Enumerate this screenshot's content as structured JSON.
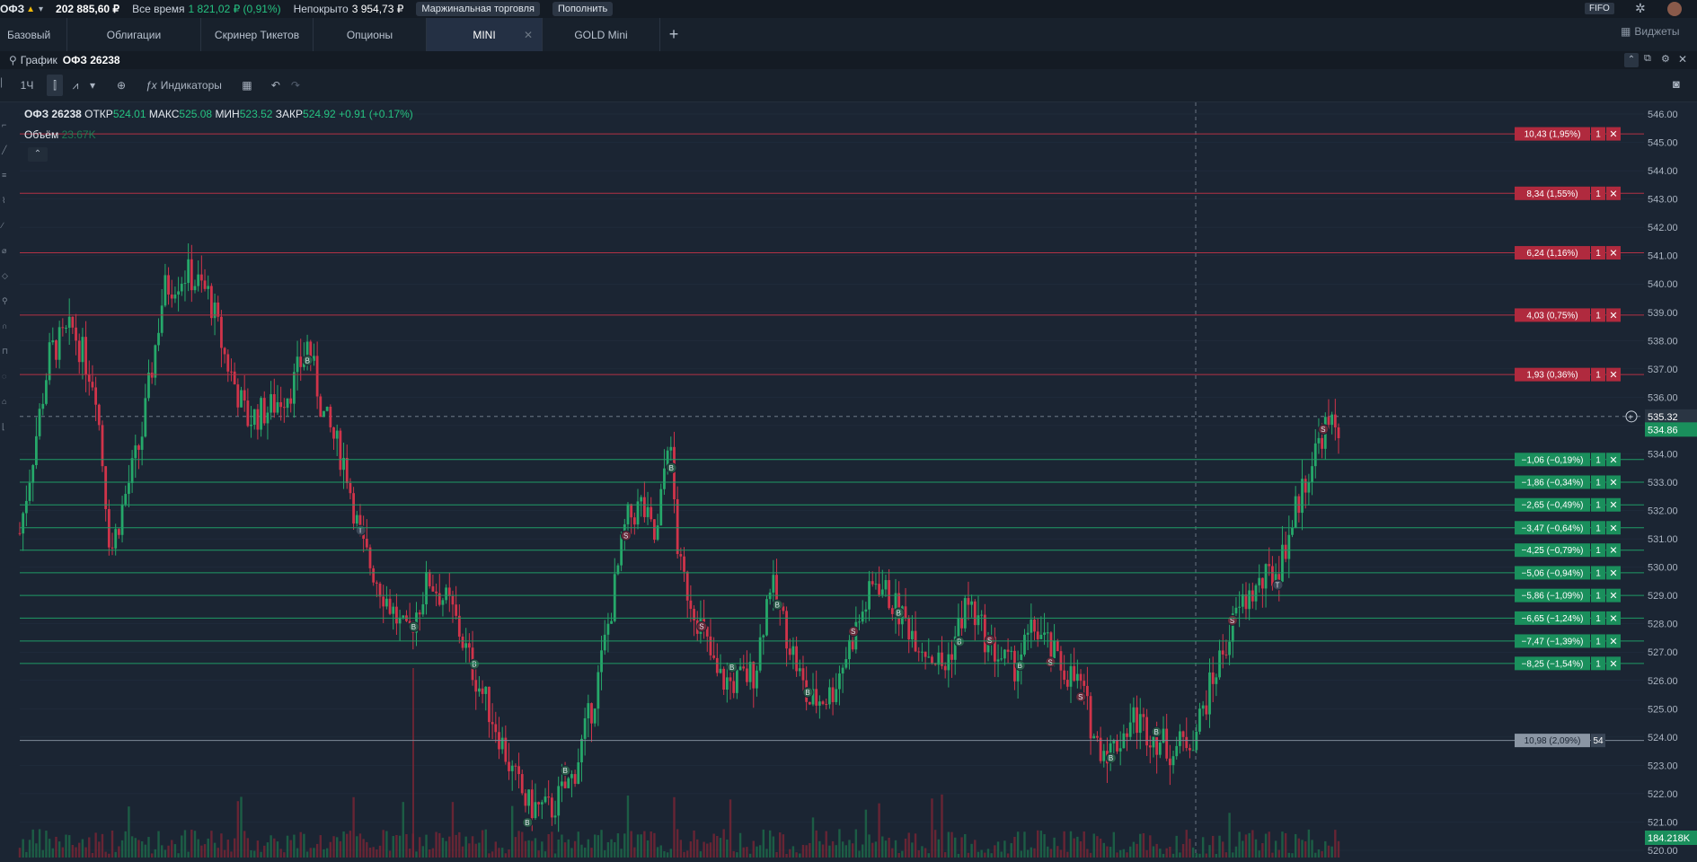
{
  "topbar": {
    "account": "ОФЗ",
    "balance": "202 885,60 ₽",
    "alltime_label": "Все время",
    "alltime_value": "1 821,02 ₽ (0,91%)",
    "uncovered_label": "Непокрыто",
    "uncovered_value": "3 954,73 ₽",
    "margin_btn": "Маржинальная торговля",
    "deposit_btn": "Пополнить",
    "fifo_btn": "FIFO"
  },
  "tabs": [
    "Базовый",
    "Облигации",
    "Скринер Тикетов",
    "Опционы",
    "MINI",
    "GOLD Mini"
  ],
  "active_tab": "MINI",
  "widgets_label": "Виджеты",
  "panel": {
    "label": "График",
    "ticker": "ОФЗ 26238"
  },
  "toolbar": {
    "interval": "1Ч",
    "indicators": "Индикаторы"
  },
  "legend": {
    "ticker": "ОФЗ 26238",
    "open_label": "ОТКР",
    "open": "524.01",
    "high_label": "МАКС",
    "high": "525.08",
    "low_label": "МИН",
    "low": "523.52",
    "close_label": "ЗАКР",
    "close": "524.92",
    "change": "+0.91 (+0.17%)",
    "volume_label": "Объём",
    "volume": "23.67K"
  },
  "colors": {
    "up": "#26a86a",
    "down": "#d0344a",
    "bg": "#1b2533",
    "grid": "#243042"
  },
  "price_axis": {
    "ticks": [
      "546.00",
      "545.00",
      "544.00",
      "543.00",
      "542.00",
      "541.00",
      "540.00",
      "539.00",
      "538.00",
      "537.00",
      "536.00",
      "535.00",
      "534.00",
      "533.00",
      "532.00",
      "531.00",
      "530.00",
      "529.00",
      "528.00",
      "527.00",
      "526.00",
      "525.00",
      "524.00",
      "523.00",
      "522.00",
      "521.00",
      "520.00"
    ],
    "min": 520.0,
    "max": 546.0,
    "current_price": "534.86",
    "crosshair_price": "535.32",
    "volume_value": "184.218K"
  },
  "sell_orders": [
    {
      "price": "545.30",
      "pnl": "10,43 (1,95%)",
      "qty": "1"
    },
    {
      "price": "543.20",
      "pnl": "8,34 (1,55%)",
      "qty": "1"
    },
    {
      "price": "541.10",
      "pnl": "6,24 (1,16%)",
      "qty": "1"
    },
    {
      "price": "538.90",
      "pnl": "4,03 (0,75%)",
      "qty": "1"
    },
    {
      "price": "536.80",
      "pnl": "1,93 (0,36%)",
      "qty": "1"
    }
  ],
  "buy_orders": [
    {
      "price": "533.80",
      "pnl": "−1,06 (−0,19%)",
      "qty": "1"
    },
    {
      "price": "533.00",
      "pnl": "−1,86 (−0,34%)",
      "qty": "1"
    },
    {
      "price": "532.20",
      "pnl": "−2,65 (−0,49%)",
      "qty": "1"
    },
    {
      "price": "531.39",
      "pnl": "−3,47 (−0,64%)",
      "qty": "1"
    },
    {
      "price": "530.60",
      "pnl": "−4,25 (−0,79%)",
      "qty": "1"
    },
    {
      "price": "529.80",
      "pnl": "−5,06 (−0,94%)",
      "qty": "1"
    },
    {
      "price": "529.00",
      "pnl": "−5,86 (−1,09%)",
      "qty": "1"
    },
    {
      "price": "528.20",
      "pnl": "−6,65 (−1,24%)",
      "qty": "1"
    },
    {
      "price": "527.39",
      "pnl": "−7,47 (−1,39%)",
      "qty": "1"
    },
    {
      "price": "526.60",
      "pnl": "−8,25 (−1,54%)",
      "qty": "1"
    }
  ],
  "position": {
    "price": "523.88",
    "pnl": "10,98 (2,09%)",
    "qty": "54"
  },
  "chart_data": {
    "type": "candlestick",
    "ylim": [
      520,
      546
    ],
    "close_path": [
      {
        "t": 0,
        "p": 531.2
      },
      {
        "t": 0.02,
        "p": 537.6
      },
      {
        "t": 0.035,
        "p": 538.4
      },
      {
        "t": 0.05,
        "p": 536.4
      },
      {
        "t": 0.06,
        "p": 530.5
      },
      {
        "t": 0.07,
        "p": 532.6
      },
      {
        "t": 0.08,
        "p": 534.5
      },
      {
        "t": 0.095,
        "p": 539.8
      },
      {
        "t": 0.11,
        "p": 540.4
      },
      {
        "t": 0.125,
        "p": 539.6
      },
      {
        "t": 0.135,
        "p": 537.5
      },
      {
        "t": 0.15,
        "p": 535.2
      },
      {
        "t": 0.165,
        "p": 535.6
      },
      {
        "t": 0.18,
        "p": 536.4
      },
      {
        "t": 0.19,
        "p": 537.9
      },
      {
        "t": 0.2,
        "p": 535.4
      },
      {
        "t": 0.215,
        "p": 533.6
      },
      {
        "t": 0.225,
        "p": 530.8
      },
      {
        "t": 0.24,
        "p": 529.1
      },
      {
        "t": 0.255,
        "p": 527.5
      },
      {
        "t": 0.27,
        "p": 529.6
      },
      {
        "t": 0.285,
        "p": 528.5
      },
      {
        "t": 0.3,
        "p": 526.2
      },
      {
        "t": 0.315,
        "p": 524.3
      },
      {
        "t": 0.325,
        "p": 522.7
      },
      {
        "t": 0.335,
        "p": 521.6
      },
      {
        "t": 0.35,
        "p": 521.4
      },
      {
        "t": 0.365,
        "p": 522.6
      },
      {
        "t": 0.38,
        "p": 525.6
      },
      {
        "t": 0.39,
        "p": 528.5
      },
      {
        "t": 0.4,
        "p": 531.6
      },
      {
        "t": 0.41,
        "p": 532.2
      },
      {
        "t": 0.42,
        "p": 530.8
      },
      {
        "t": 0.428,
        "p": 534.9
      },
      {
        "t": 0.435,
        "p": 530.0
      },
      {
        "t": 0.45,
        "p": 527.8
      },
      {
        "t": 0.46,
        "p": 526.1
      },
      {
        "t": 0.47,
        "p": 525.9
      },
      {
        "t": 0.485,
        "p": 526.3
      },
      {
        "t": 0.495,
        "p": 529.5
      },
      {
        "t": 0.51,
        "p": 527.0
      },
      {
        "t": 0.52,
        "p": 525.2
      },
      {
        "t": 0.535,
        "p": 525.5
      },
      {
        "t": 0.55,
        "p": 527.6
      },
      {
        "t": 0.565,
        "p": 529.6
      },
      {
        "t": 0.58,
        "p": 528.4
      },
      {
        "t": 0.595,
        "p": 527.3
      },
      {
        "t": 0.61,
        "p": 526.4
      },
      {
        "t": 0.625,
        "p": 528.8
      },
      {
        "t": 0.64,
        "p": 527.2
      },
      {
        "t": 0.655,
        "p": 526.4
      },
      {
        "t": 0.67,
        "p": 527.9
      },
      {
        "t": 0.685,
        "p": 526.6
      },
      {
        "t": 0.7,
        "p": 525.8
      },
      {
        "t": 0.71,
        "p": 523.8
      },
      {
        "t": 0.72,
        "p": 523.5
      },
      {
        "t": 0.735,
        "p": 524.7
      },
      {
        "t": 0.745,
        "p": 524.2
      },
      {
        "t": 0.76,
        "p": 523.5
      },
      {
        "t": 0.775,
        "p": 524.1
      },
      {
        "t": 0.79,
        "p": 526.5
      },
      {
        "t": 0.805,
        "p": 528.6
      },
      {
        "t": 0.815,
        "p": 529.2
      },
      {
        "t": 0.83,
        "p": 529.9
      },
      {
        "t": 0.845,
        "p": 532.6
      },
      {
        "t": 0.86,
        "p": 534.9
      },
      {
        "t": 0.87,
        "p": 534.9
      }
    ]
  }
}
